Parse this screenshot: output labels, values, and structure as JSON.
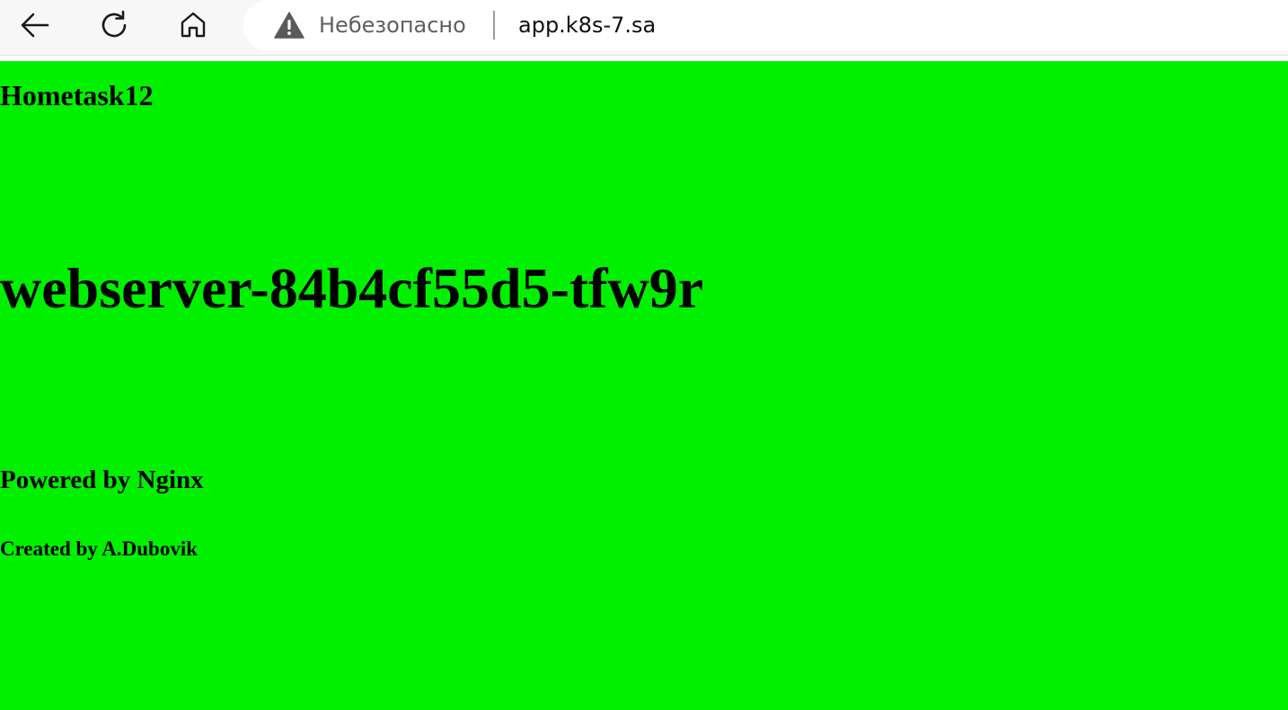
{
  "browser": {
    "nav": {
      "back_icon": "arrow-left-icon",
      "reload_icon": "refresh-icon",
      "home_icon": "home-icon"
    },
    "address_bar": {
      "security_icon": "warning-triangle-icon",
      "security_label": "Небезопасно",
      "url": "app.k8s-7.sa"
    }
  },
  "page": {
    "background_color": "#00f000",
    "title": "Hometask12",
    "hostname": "webserver-84b4cf55d5-tfw9r",
    "powered_by": "Powered by Nginx",
    "created_by": "Created by A.Dubovik"
  }
}
